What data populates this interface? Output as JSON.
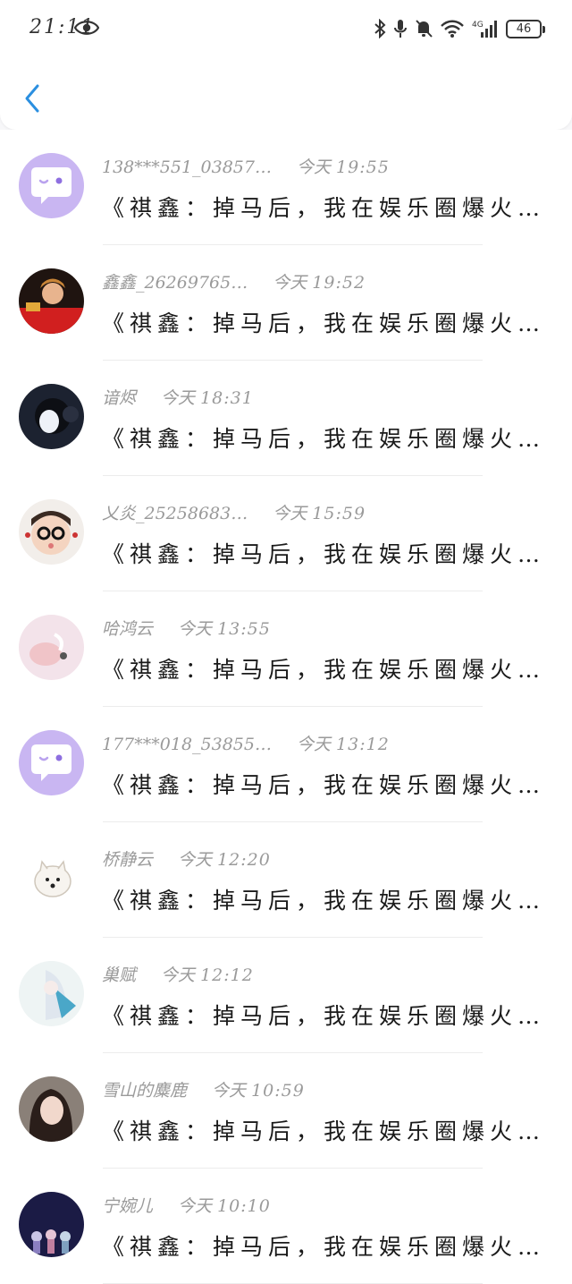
{
  "status_bar": {
    "time": "21:11",
    "battery": "46",
    "network": "4G"
  },
  "nav": {
    "back_icon": "chevron-left-icon",
    "accent_color": "#2b8fe0"
  },
  "messages": [
    {
      "name": "138***551_03857…",
      "date": "今天",
      "time": "19:55",
      "text": "《祺鑫：掉马后，我在娱乐圈爆火…",
      "avatar": "chat-bubble"
    },
    {
      "name": "鑫鑫_26269765…",
      "date": "今天",
      "time": "19:52",
      "text": "《祺鑫：掉马后，我在娱乐圈爆火…",
      "avatar": "photo"
    },
    {
      "name": "谙烬",
      "date": "今天",
      "time": "18:31",
      "text": "《祺鑫：掉马后，我在娱乐圈爆火…",
      "avatar": "photo"
    },
    {
      "name": "乂炎_25258683…",
      "date": "今天",
      "time": "15:59",
      "text": "《祺鑫：掉马后，我在娱乐圈爆火…",
      "avatar": "photo"
    },
    {
      "name": "哈鸿云",
      "date": "今天",
      "time": "13:55",
      "text": "《祺鑫：掉马后，我在娱乐圈爆火…",
      "avatar": "photo"
    },
    {
      "name": "177***018_53855…",
      "date": "今天",
      "time": "13:12",
      "text": "《祺鑫：掉马后，我在娱乐圈爆火…",
      "avatar": "chat-bubble"
    },
    {
      "name": "桥静云",
      "date": "今天",
      "time": "12:20",
      "text": "《祺鑫：掉马后，我在娱乐圈爆火…",
      "avatar": "photo"
    },
    {
      "name": "巢赋",
      "date": "今天",
      "time": "12:12",
      "text": "《祺鑫：掉马后，我在娱乐圈爆火…",
      "avatar": "photo"
    },
    {
      "name": "雪山的麋鹿",
      "date": "今天",
      "time": "10:59",
      "text": "《祺鑫：掉马后，我在娱乐圈爆火…",
      "avatar": "photo"
    },
    {
      "name": "宁婉儿",
      "date": "今天",
      "time": "10:10",
      "text": "《祺鑫：掉马后，我在娱乐圈爆火…",
      "avatar": "photo"
    }
  ]
}
